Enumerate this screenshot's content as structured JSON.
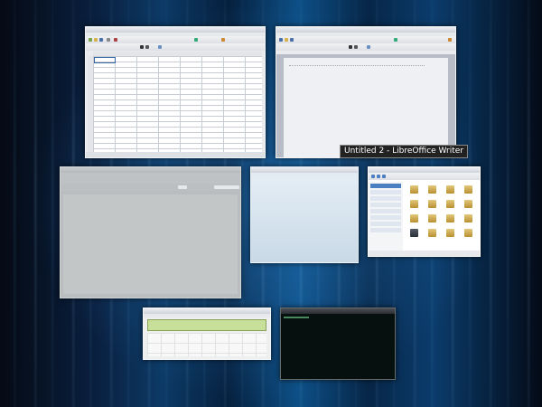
{
  "desktop": {
    "highlighted_window_label": "Untitled 2 - LibreOffice Writer"
  },
  "colors": {
    "accent": "#3465a4",
    "calculator_display": "#c8df9a",
    "folder": "#d9b65a"
  },
  "windows": [
    {
      "id": "calc",
      "kind": "spreadsheet"
    },
    {
      "id": "writer",
      "kind": "word-processor"
    },
    {
      "id": "wide",
      "kind": "application"
    },
    {
      "id": "blank",
      "kind": "application"
    },
    {
      "id": "files",
      "kind": "file-manager"
    },
    {
      "id": "calculator",
      "kind": "calculator"
    },
    {
      "id": "terminal",
      "kind": "terminal"
    }
  ]
}
